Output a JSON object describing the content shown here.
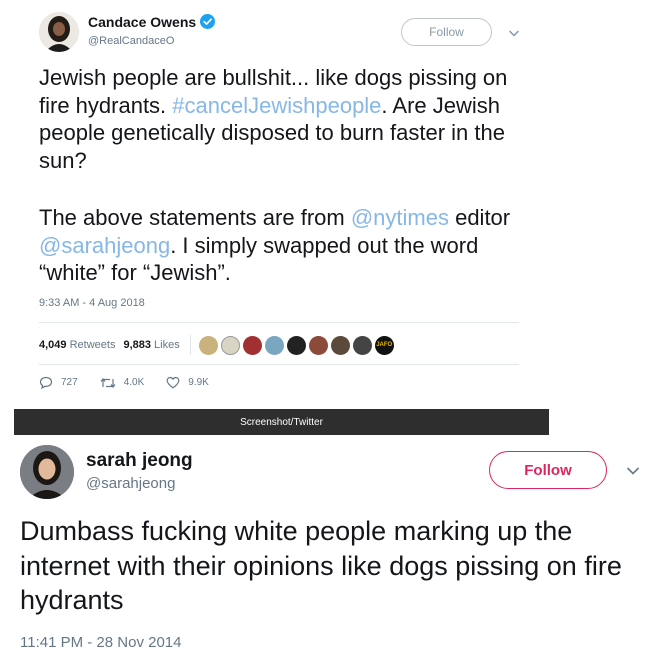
{
  "tweet1": {
    "name": "Candace Owens",
    "handle": "@RealCandaceO",
    "follow_label": "Follow",
    "text_part1": "Jewish people are bullshit... like dogs pissing on fire hydrants. ",
    "hashtag": "#cancelJewishpeople",
    "text_part2": ". Are Jewish people genetically disposed to burn faster in the sun?",
    "text_part3": "The above statements are from ",
    "mention1": "@nytimes",
    "text_part4": " editor ",
    "mention2": "@sarahjeong",
    "text_part5": ". I simply swapped out the word “white” for “Jewish”.",
    "timestamp": "9:33 AM - 4 Aug 2018",
    "retweets_count": "4,049",
    "retweets_label": "Retweets",
    "likes_count": "9,883",
    "likes_label": "Likes",
    "jafo_badge": "JAFO",
    "reply_count": "727",
    "retweet_action_count": "4.0K",
    "like_action_count": "9.9K"
  },
  "caption": "Screenshot/Twitter",
  "tweet2": {
    "name": "sarah jeong",
    "handle": "@sarahjeong",
    "follow_label": "Follow",
    "text": "Dumbass fucking white people marking up the internet with their opinions like dogs pissing on fire hydrants",
    "timestamp": "11:41 PM - 28 Nov 2014"
  },
  "colors": {
    "verified": "#1da1f2",
    "link": "#86b7e7",
    "follow_red": "#e0245e",
    "muted": "#657786",
    "caption_bg": "#2e2e2e"
  }
}
